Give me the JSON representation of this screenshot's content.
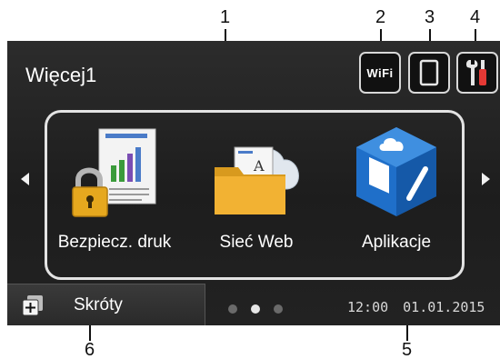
{
  "callouts": [
    "1",
    "2",
    "3",
    "4",
    "5",
    "6"
  ],
  "screen": {
    "title": "Więcej1",
    "status_icons": {
      "wifi_label": "WiFi",
      "wifi_icon": "wifi-status-icon",
      "toner_icon": "toner-icon",
      "settings_icon": "settings-tools-icon"
    },
    "apps": [
      {
        "label": "Bezpiecz. druk",
        "icon": "secure-print-icon"
      },
      {
        "label": "Sieć Web",
        "icon": "web-connect-icon"
      },
      {
        "label": "Aplikacje",
        "icon": "apps-icon"
      }
    ],
    "shortcuts_label": "Skróty",
    "time": "12:00",
    "date": "01.01.2015",
    "page_dots": {
      "count": 3,
      "active_index": 1
    }
  },
  "colors": {
    "screen_bg": "#232323",
    "frame": "#e3e3e3",
    "folder": "#f2b233",
    "cube": "#1f6fc9",
    "lock": "#e6a81e",
    "settings_red": "#e53935"
  }
}
